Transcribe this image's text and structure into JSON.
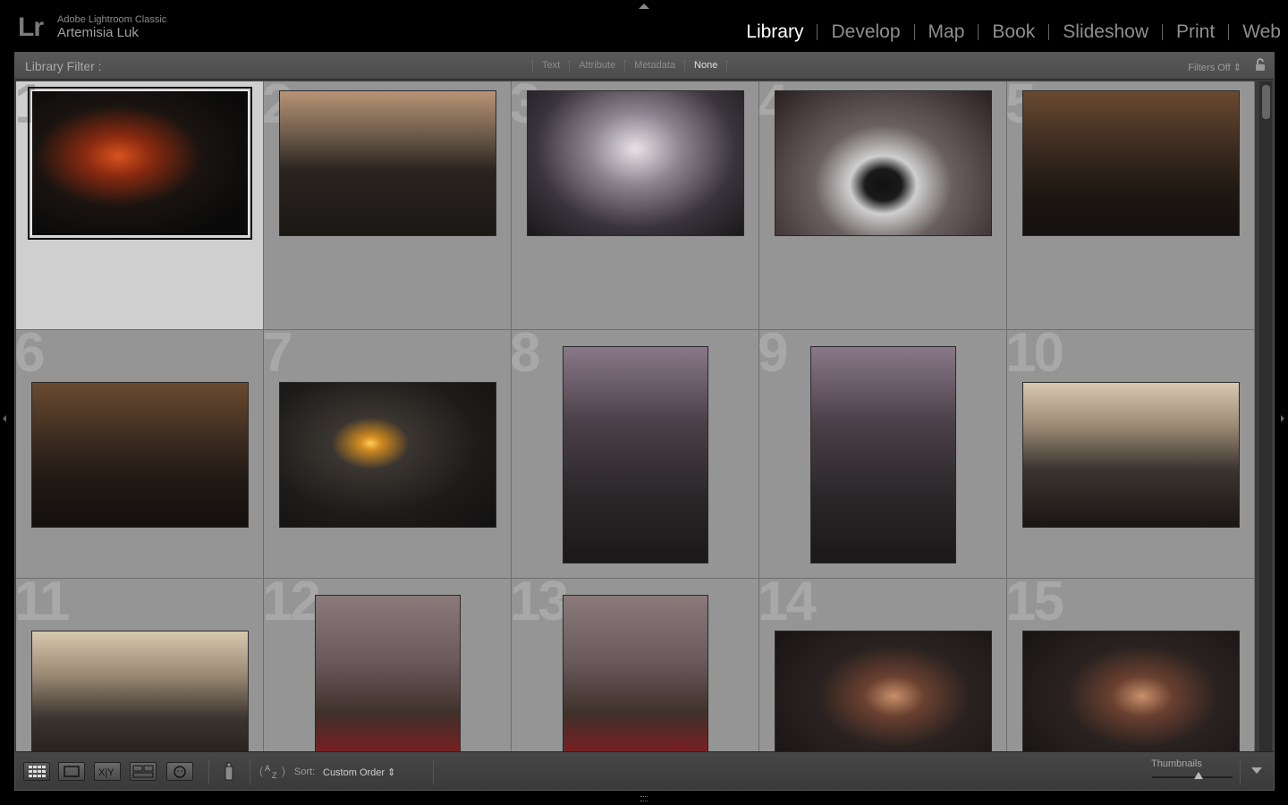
{
  "app": {
    "logo": "Lr",
    "product": "Adobe Lightroom Classic",
    "user": "Artemisia Luk"
  },
  "modules": [
    "Library",
    "Develop",
    "Map",
    "Book",
    "Slideshow",
    "Print",
    "Web"
  ],
  "active_module": "Library",
  "filter": {
    "title": "Library Filter :",
    "tabs": [
      "Text",
      "Attribute",
      "Metadata",
      "None"
    ],
    "active_tab": "None",
    "status": "Filters Off ⇕"
  },
  "grid": {
    "cells": [
      {
        "num": "1",
        "selected": true
      },
      {
        "num": "2"
      },
      {
        "num": "3"
      },
      {
        "num": "4"
      },
      {
        "num": "5"
      },
      {
        "num": "6"
      },
      {
        "num": "7"
      },
      {
        "num": "8"
      },
      {
        "num": "9"
      },
      {
        "num": "10"
      },
      {
        "num": "11"
      },
      {
        "num": "12"
      },
      {
        "num": "13"
      },
      {
        "num": "14"
      },
      {
        "num": "15"
      }
    ]
  },
  "toolbar": {
    "sort_label": "Sort:",
    "sort_value": "Custom Order ⇕",
    "thumbnails_label": "Thumbnails",
    "thumbnail_size": 0.55
  },
  "colors": {
    "active_module": "#ffffff",
    "inactive_module": "#8e8e8e",
    "grid_background": "#959595",
    "selected_cell": "#cfcfcf"
  }
}
